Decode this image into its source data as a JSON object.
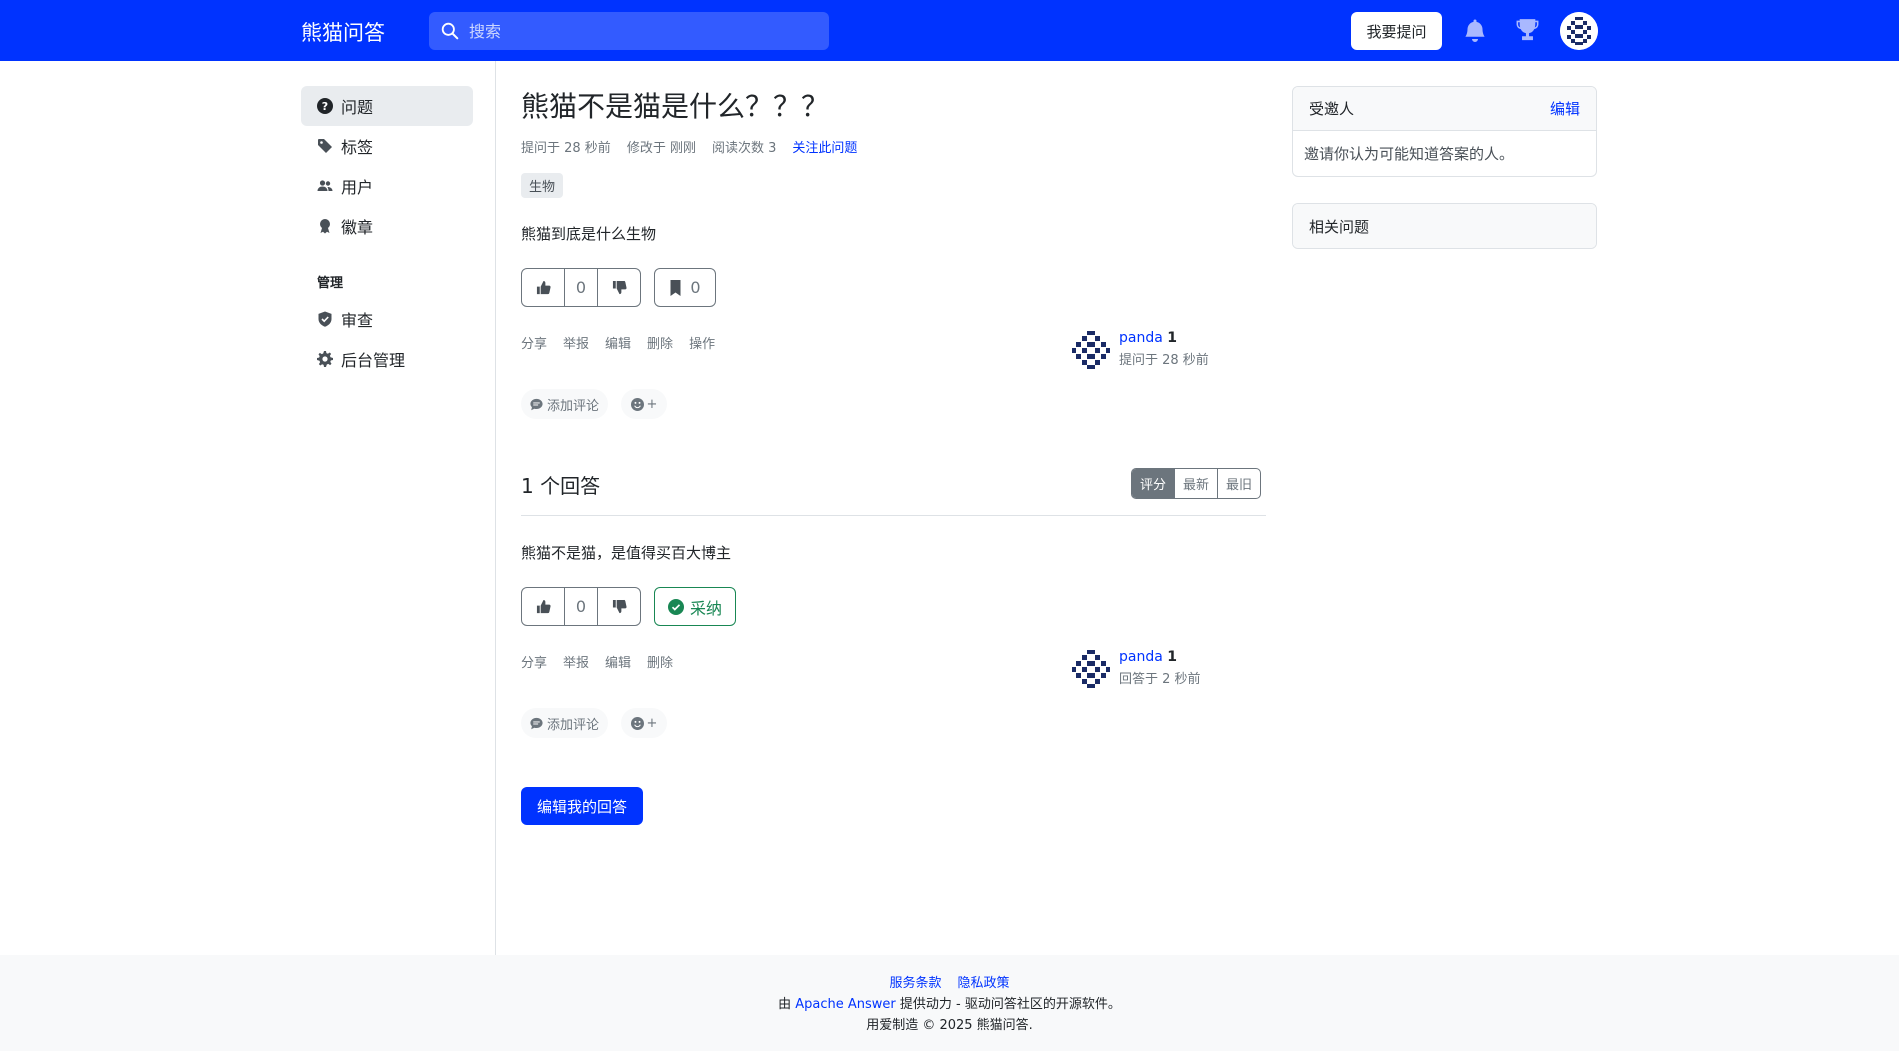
{
  "header": {
    "brand": "熊猫问答",
    "search_placeholder": "搜索",
    "ask_label": "我要提问",
    "icons": [
      "search-icon",
      "bell-icon",
      "trophy-icon",
      "avatar"
    ]
  },
  "sidebar": {
    "items": [
      {
        "label": "问题",
        "icon": "question-circle-icon"
      },
      {
        "label": "标签",
        "icon": "tag-icon"
      },
      {
        "label": "用户",
        "icon": "people-icon"
      },
      {
        "label": "徽章",
        "icon": "award-icon"
      }
    ],
    "admin_title": "管理",
    "admin_items": [
      {
        "label": "审查",
        "icon": "shield-check-icon"
      },
      {
        "label": "后台管理",
        "icon": "gear-icon"
      }
    ]
  },
  "question": {
    "title": "熊猫不是猫是什么？？？",
    "asked": "提问于 28 秒前",
    "modified": "修改于 刚刚",
    "views": "阅读次数 3",
    "follow": "关注此问题",
    "tag": "生物",
    "body": "熊猫到底是什么生物",
    "votes": "0",
    "bookmarks": "0",
    "actions": [
      "分享",
      "举报",
      "编辑",
      "删除",
      "操作"
    ],
    "author_name": "panda",
    "author_rep": "1",
    "author_time": "提问于 28 秒前",
    "add_comment": "添加评论",
    "emoji_plus": "+"
  },
  "answers": {
    "heading": "1 个回答",
    "sort_options": [
      "评分",
      "最新",
      "最旧"
    ],
    "items": [
      {
        "body": "熊猫不是猫，是值得买百大博主",
        "votes": "0",
        "accept": "采纳",
        "actions": [
          "分享",
          "举报",
          "编辑",
          "删除"
        ],
        "author_name": "panda",
        "author_rep": "1",
        "author_time": "回答于 2 秒前",
        "add_comment": "添加评论",
        "emoji_plus": "+"
      }
    ],
    "edit_my_answer": "编辑我的回答"
  },
  "right": {
    "invitees_title": "受邀人",
    "invitees_edit": "编辑",
    "invitees_body": "邀请你认为可能知道答案的人。",
    "related_title": "相关问题"
  },
  "footer": {
    "terms": "服务条款",
    "privacy": "隐私政策",
    "powered_pre": "由",
    "powered_link": "Apache Answer",
    "powered_post": "提供动力 - 驱动问答社区的开源软件。",
    "copyright": "用爱制造 © 2025 熊猫问答."
  },
  "colors": {
    "primary": "#0033ff",
    "success": "#198754",
    "muted": "#6c757d"
  }
}
